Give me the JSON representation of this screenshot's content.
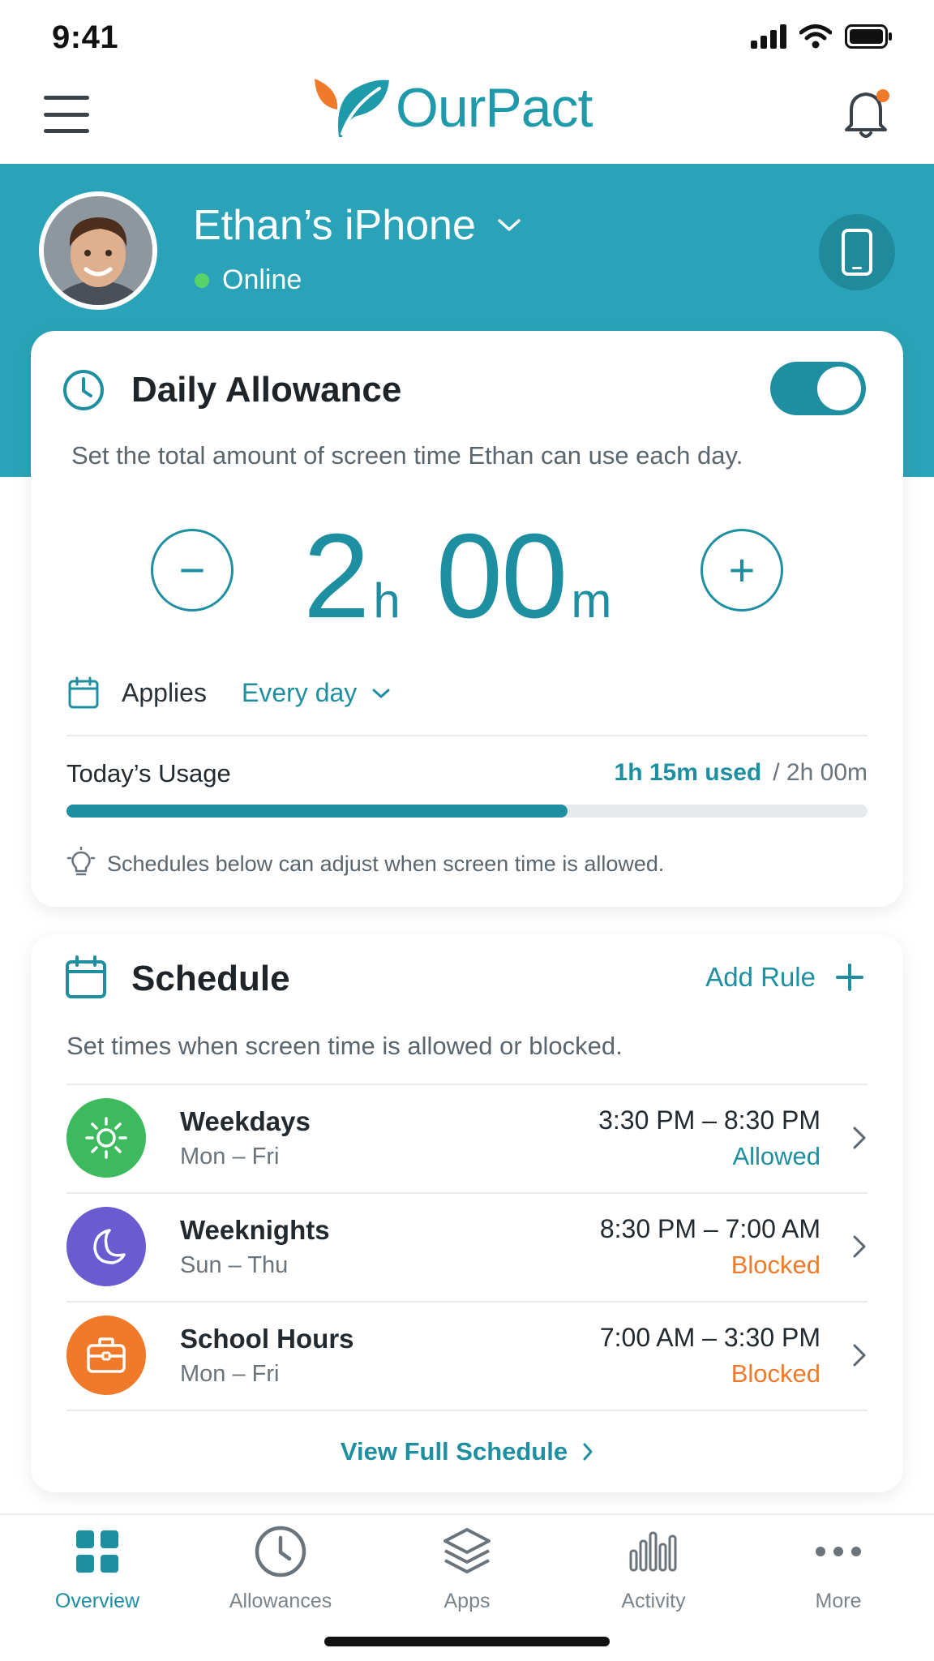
{
  "status_bar": {
    "time": "9:41"
  },
  "header": {
    "brand": "OurPact"
  },
  "device": {
    "name": "Ethan’s iPhone",
    "status": "Online"
  },
  "daily_allowance": {
    "title": "Daily Allowance",
    "enabled": true,
    "description": "Set the total amount of screen time Ethan can use each day.",
    "hours": "2",
    "hours_unit": "h",
    "minutes": "00",
    "minutes_unit": "m",
    "decrement_symbol": "−",
    "increment_symbol": "+",
    "applies_label": "Applies",
    "applies_value": "Every day",
    "usage_label": "Today’s Usage",
    "usage_used": "1h 15m used",
    "usage_total": "/ 2h 00m",
    "usage_fraction": 0.625,
    "tip": "Schedules below can adjust when screen time is allowed."
  },
  "schedule": {
    "title": "Schedule",
    "add_rule_label": "Add Rule",
    "description": "Set times when screen time is allowed or blocked.",
    "rules": [
      {
        "name": "Weekdays",
        "days": "Mon – Fri",
        "time": "3:30 PM – 8:30 PM",
        "status": "Allowed",
        "icon": "sun-icon",
        "icon_color": "#3dba5e",
        "status_color": "#1e8fa1"
      },
      {
        "name": "Weeknights",
        "days": "Sun – Thu",
        "time": "8:30 PM – 7:00 AM",
        "status": "Blocked",
        "icon": "moon-icon",
        "icon_color": "#6a5bd0",
        "status_color": "#f07a2a"
      },
      {
        "name": "School Hours",
        "days": "Mon – Fri",
        "time": "7:00 AM – 3:30 PM",
        "status": "Blocked",
        "icon": "briefcase-icon",
        "icon_color": "#f07a2a",
        "status_color": "#f07a2a"
      }
    ],
    "view_full_label": "View Full Schedule"
  },
  "bottom_nav": {
    "items": [
      {
        "label": "Overview",
        "icon": "grid-icon",
        "active": true
      },
      {
        "label": "Allowances",
        "icon": "clock-icon",
        "active": false
      },
      {
        "label": "Apps",
        "icon": "layers-icon",
        "active": false
      },
      {
        "label": "Activity",
        "icon": "bar-chart-icon",
        "active": false
      },
      {
        "label": "More",
        "icon": "more-icon",
        "active": false
      }
    ]
  },
  "colors": {
    "teal": "#2aa3b8",
    "accent": "#1e8fa1",
    "orange": "#f07a2a",
    "online": "#58d36a"
  }
}
